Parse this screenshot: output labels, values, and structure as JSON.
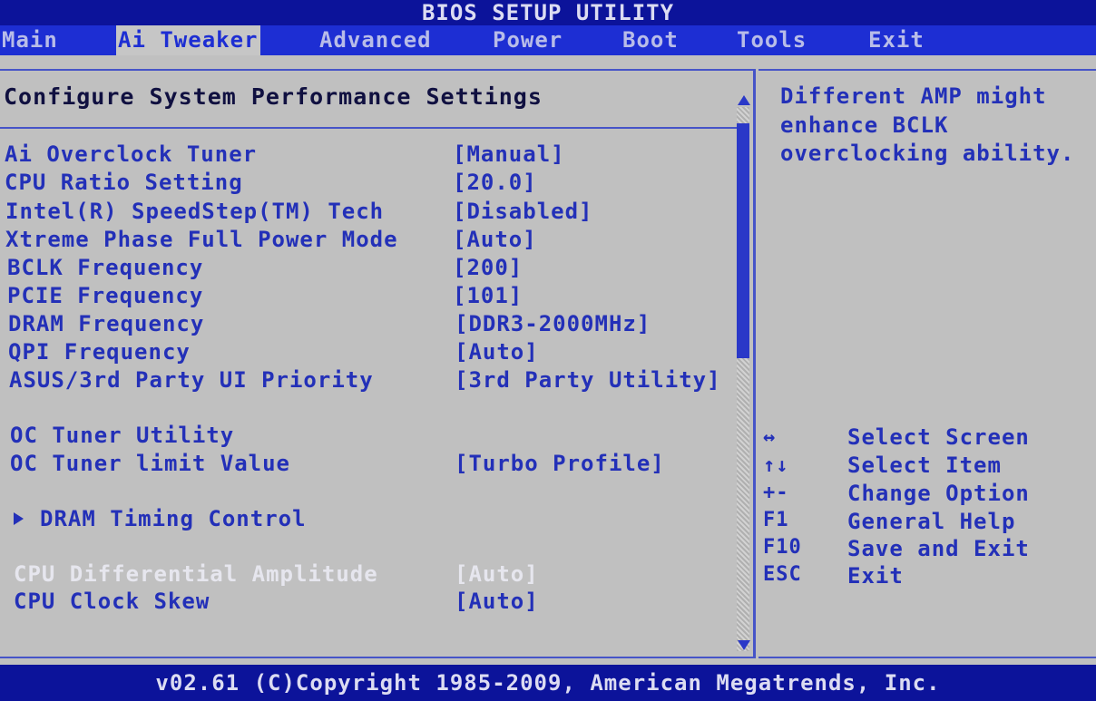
{
  "title": "BIOS SETUP UTILITY",
  "menu": [
    {
      "label": "Main",
      "active": false
    },
    {
      "label": "Ai Tweaker",
      "active": true
    },
    {
      "label": "Advanced",
      "active": false
    },
    {
      "label": "Power",
      "active": false
    },
    {
      "label": "Boot",
      "active": false
    },
    {
      "label": "Tools",
      "active": false
    },
    {
      "label": "Exit",
      "active": false
    }
  ],
  "section_title": "Configure System Performance Settings",
  "settings": [
    {
      "label": "Ai Overclock Tuner",
      "value": "[Manual]"
    },
    {
      "label": "CPU Ratio Setting",
      "value": "[20.0]"
    },
    {
      "label": "Intel(R) SpeedStep(TM) Tech",
      "value": "[Disabled]"
    },
    {
      "label": "Xtreme Phase Full Power Mode",
      "value": "[Auto]"
    },
    {
      "label": "BCLK Frequency",
      "value": "[200]"
    },
    {
      "label": "PCIE Frequency",
      "value": "[101]"
    },
    {
      "label": "DRAM Frequency",
      "value": "[DDR3-2000MHz]"
    },
    {
      "label": "QPI Frequency",
      "value": "[Auto]"
    },
    {
      "label": "ASUS/3rd Party UI Priority",
      "value": "[3rd Party Utility]"
    },
    {
      "label": "OC Tuner Utility",
      "value": ""
    },
    {
      "label": "OC Tuner limit Value",
      "value": "[Turbo Profile]"
    },
    {
      "label": "DRAM Timing Control",
      "value": "",
      "submenu": true
    },
    {
      "label": "CPU Differential Amplitude",
      "value": "[Auto]",
      "disabled": true
    },
    {
      "label": "CPU Clock Skew",
      "value": "[Auto]"
    }
  ],
  "help": {
    "lines": [
      "Different AMP might",
      "enhance BCLK",
      "overclocking ability."
    ]
  },
  "keys": [
    {
      "key": "↔",
      "desc": "Select Screen"
    },
    {
      "key": "↑↓",
      "desc": "Select Item"
    },
    {
      "key": "+-",
      "desc": "Change Option"
    },
    {
      "key": "F1",
      "desc": "General Help"
    },
    {
      "key": "F10",
      "desc": "Save and Exit"
    },
    {
      "key": "ESC",
      "desc": "Exit"
    }
  ],
  "scrollbar": {
    "position": 0.0,
    "visible_fraction": 0.46
  },
  "footer": "v02.61 (C)Copyright 1985-2009, American Megatrends, Inc.",
  "colors": {
    "background": "#0a0f8c",
    "menu_bar": "#1d2ed3",
    "panel": "#c0c0c0",
    "text_blue": "#2330b8",
    "text_disabled": "#e6e6ee"
  }
}
